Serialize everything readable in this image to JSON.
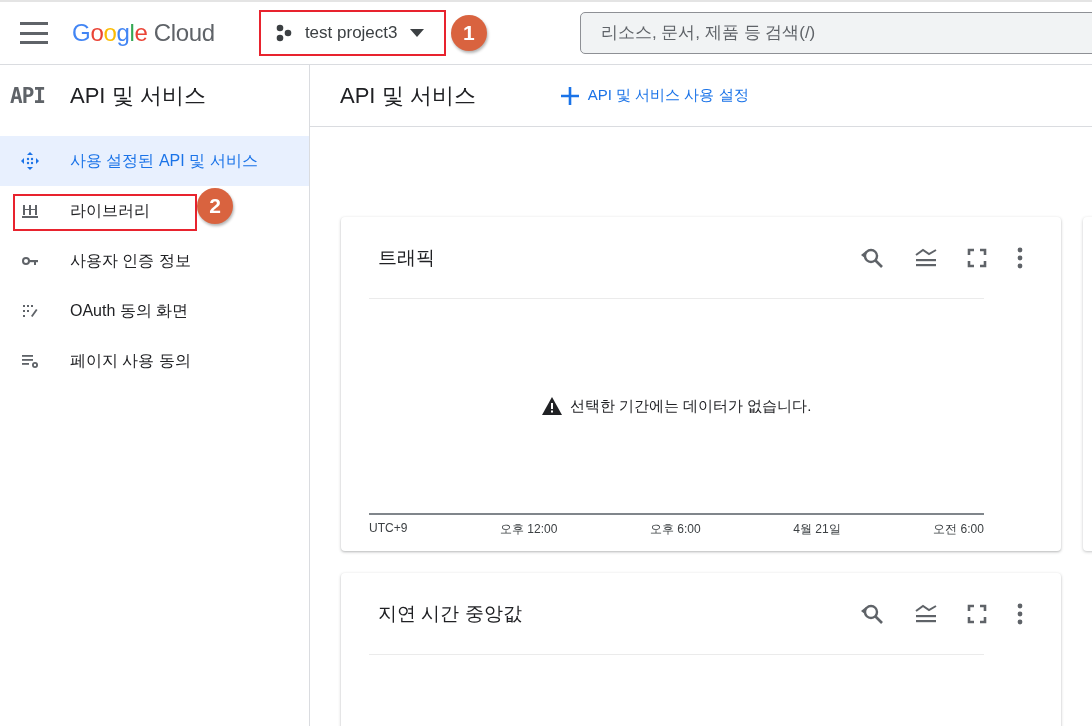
{
  "top_bar": {
    "logo": {
      "brand": "Google",
      "product": "Cloud"
    },
    "project": {
      "name": "test project3",
      "annotation": "1"
    },
    "search": {
      "placeholder": "리소스, 문서, 제품 등 검색(/)"
    }
  },
  "sidebar": {
    "badge": "API",
    "title": "API 및 서비스",
    "items": [
      {
        "label": "사용 설정된 API 및 서비스",
        "kind": "enabled",
        "selected": true
      },
      {
        "label": "라이브러리",
        "kind": "library",
        "selected": false,
        "annotation": "2"
      },
      {
        "label": "사용자 인증 정보",
        "kind": "credentials",
        "selected": false
      },
      {
        "label": "OAuth 동의 화면",
        "kind": "consent",
        "selected": false
      },
      {
        "label": "페이지 사용 동의",
        "kind": "agreements",
        "selected": false
      }
    ]
  },
  "main": {
    "title": "API 및 서비스",
    "action": "API 및 서비스 사용 설정",
    "cards": [
      {
        "title": "트래픽",
        "message": "선택한 기간에는 데이터가 없습니다.",
        "axis_labels": [
          "UTC+9",
          "오후 12:00",
          "오후 6:00",
          "4월 21일",
          "오전 6:00"
        ]
      },
      {
        "title": "지연 시간 중앙값"
      }
    ]
  }
}
